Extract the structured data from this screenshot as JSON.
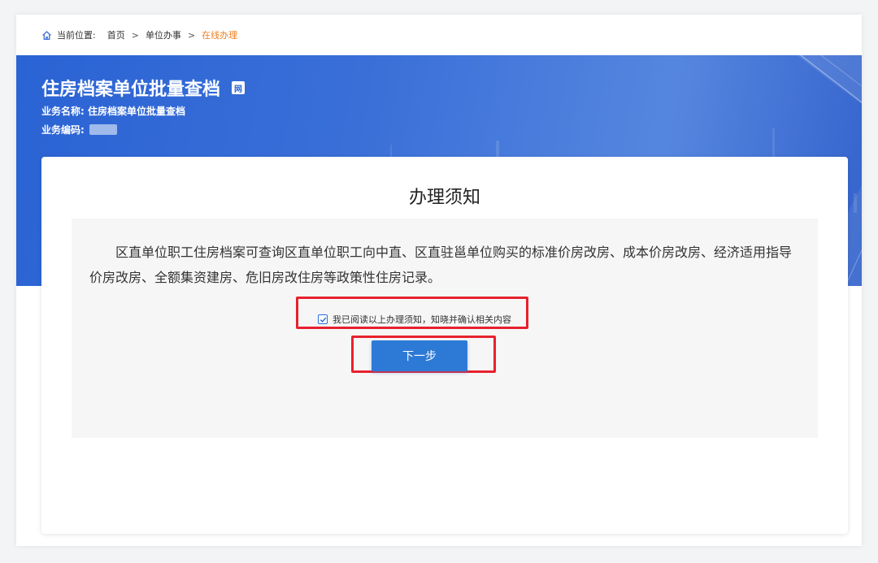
{
  "breadcrumb": {
    "label": "当前位置:",
    "items": [
      "首页",
      "单位办事",
      "在线办理"
    ],
    "separator": ">"
  },
  "banner": {
    "title": "住房档案单位批量查档",
    "badge": "网",
    "business_name_label": "业务名称:",
    "business_name_value": "住房档案单位批量查档",
    "business_code_label": "业务编码:"
  },
  "notice": {
    "title": "办理须知",
    "text": "区直单位职工住房档案可查询区直单位职工向中直、区直驻邕单位购买的标准价房改房、成本价房改房、经济适用指导价房改房、全额集资建房、危旧房改住房等政策性住房记录。"
  },
  "confirm": {
    "checked": true,
    "label": "我已阅读以上办理须知，知晓并确认相关内容"
  },
  "actions": {
    "next_label": "下一步"
  },
  "colors": {
    "accent": "#2d7ad6",
    "banner": "#2a63d4",
    "current_crumb": "#f07f20",
    "highlight_frame": "#e7212e"
  },
  "icons": {
    "home": "home-icon",
    "check": "check-icon"
  }
}
